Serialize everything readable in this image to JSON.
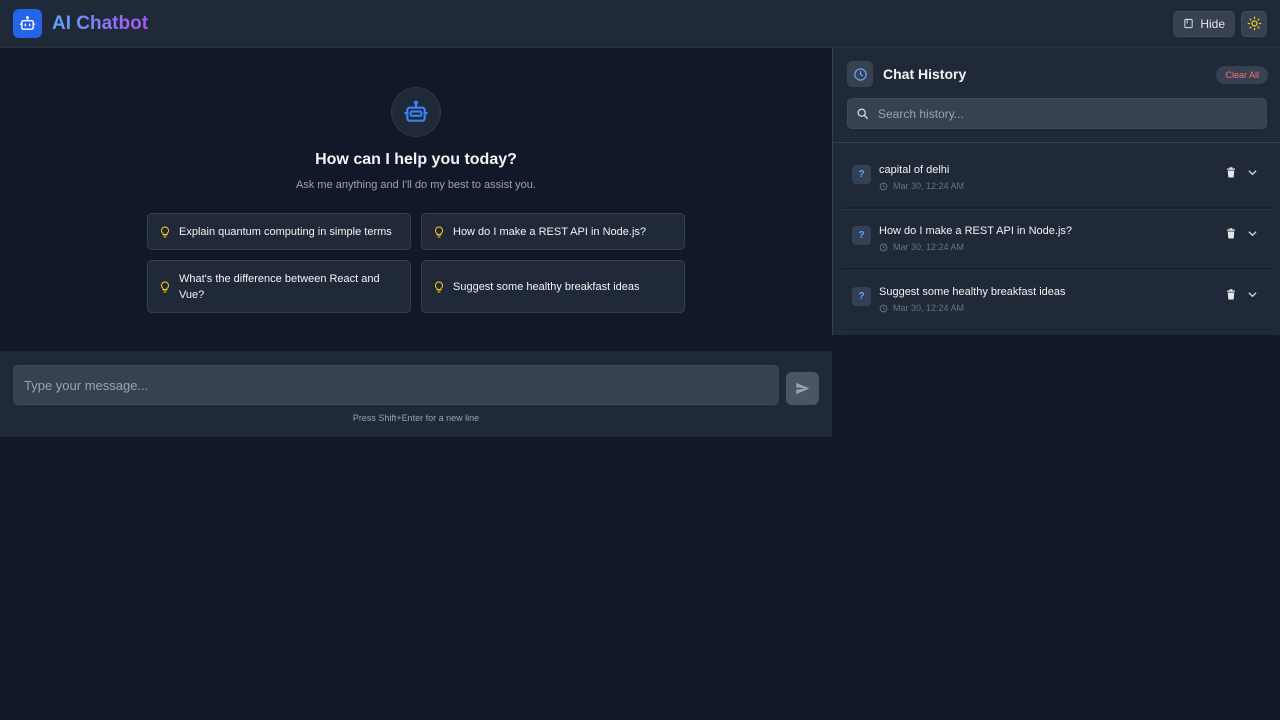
{
  "header": {
    "title": "AI Chatbot",
    "hide_label": "Hide"
  },
  "welcome": {
    "title": "How can I help you today?",
    "subtitle": "Ask me anything and I'll do my best to assist you."
  },
  "suggestions": [
    "Explain quantum computing in simple terms",
    "How do I make a REST API in Node.js?",
    "What's the difference between React and Vue?",
    "Suggest some healthy breakfast ideas"
  ],
  "input": {
    "placeholder": "Type your message...",
    "hint": "Press Shift+Enter for a new line"
  },
  "history": {
    "title": "Chat History",
    "clear_label": "Clear All",
    "search_placeholder": "Search history...",
    "items": [
      {
        "title": "capital of delhi",
        "time": "Mar 30, 12:24 AM"
      },
      {
        "title": "How do I make a REST API in Node.js?",
        "time": "Mar 30, 12:24 AM"
      },
      {
        "title": "Suggest some healthy breakfast ideas",
        "time": "Mar 30, 12:24 AM"
      }
    ]
  },
  "colors": {
    "background": "#111827",
    "panel": "#1f2937",
    "accent": "#2563eb",
    "danger": "#f87171",
    "bulb": "#facc15"
  }
}
